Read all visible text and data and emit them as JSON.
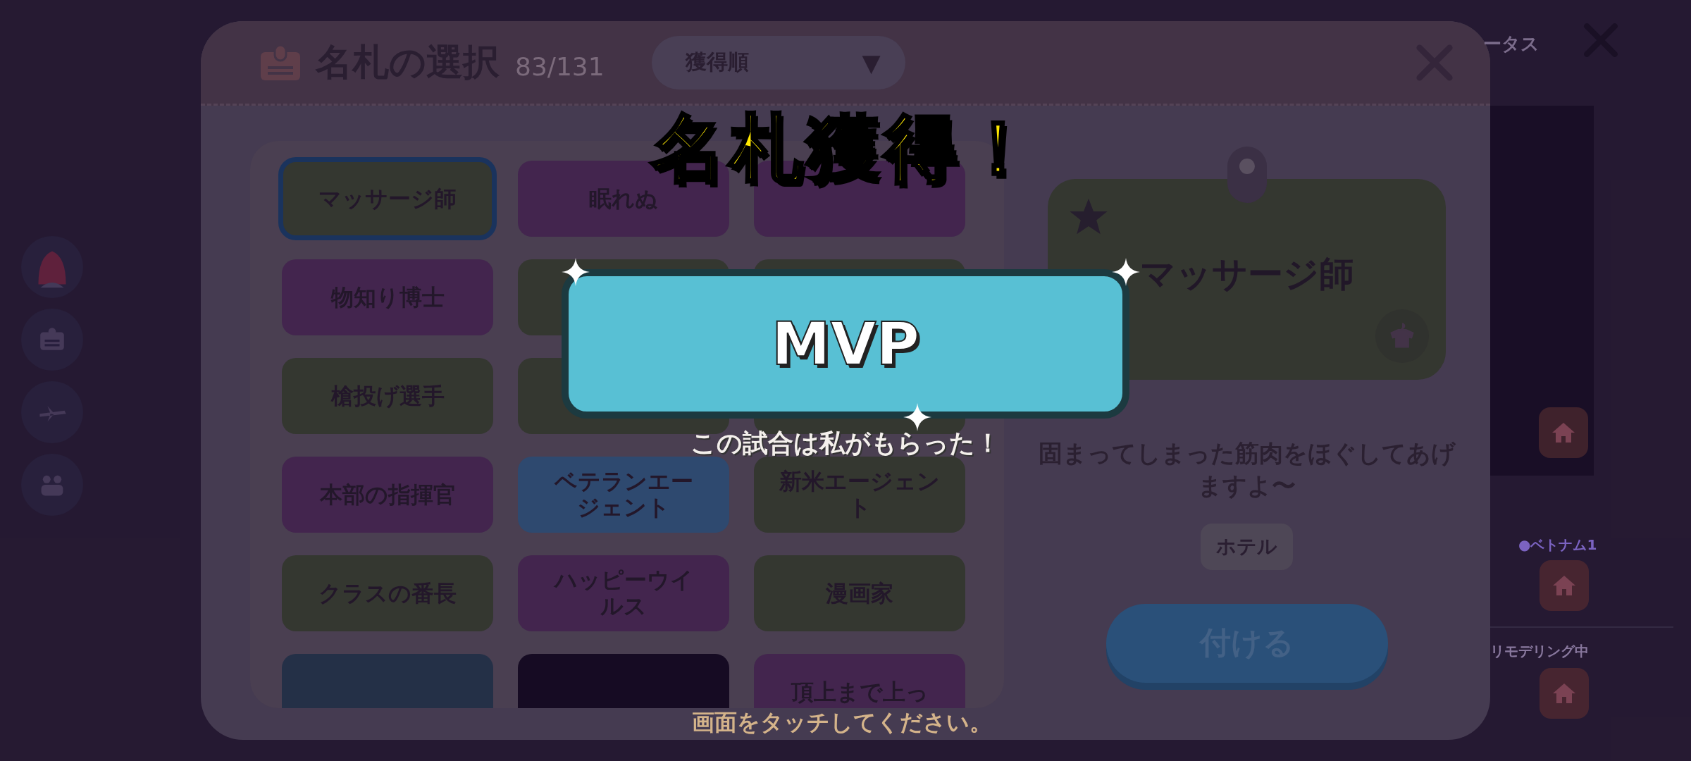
{
  "sidebar": {
    "items": [
      {
        "kind": "avatar"
      },
      {
        "kind": "badge"
      },
      {
        "kind": "plane"
      },
      {
        "kind": "group"
      }
    ]
  },
  "background": {
    "status_label": "ータス",
    "region_label": "●ベトナム1",
    "remodel_label": "リモデリング中"
  },
  "dialog": {
    "title": "名札の選択",
    "count": "83/131",
    "sort": {
      "value": "獲得順",
      "caret": "▼"
    },
    "nameplates": [
      {
        "label": "マッサージ師",
        "color": "#3a3e33",
        "selected": true
      },
      {
        "label": "眠れぬ",
        "color": "#4a2a55",
        "selected": false
      },
      {
        "color": "#4a2a55",
        "selected": false
      },
      {
        "label": "物知り博士",
        "color": "#4a2a55",
        "selected": false
      },
      {
        "color": "#3a3e33",
        "selected": false
      },
      {
        "color": "#3a3e33",
        "selected": false
      },
      {
        "label": "槍投げ選手",
        "color": "#3a3e33",
        "selected": false
      },
      {
        "color": "#3a3e33",
        "selected": false
      },
      {
        "color": "#3a3e33",
        "selected": false
      },
      {
        "label": "本部の指揮官",
        "color": "#4a2a55",
        "selected": false
      },
      {
        "label": "ベテランエージェント",
        "color": "#33527a",
        "selected": false
      },
      {
        "label": "新米エージェント",
        "color": "#3a3e33",
        "selected": false
      },
      {
        "label": "クラスの番長",
        "color": "#3a3e33",
        "selected": false
      },
      {
        "label": "ハッピーウイルス",
        "color": "#4a2a55",
        "selected": false
      },
      {
        "label": "漫画家",
        "color": "#3a3e33",
        "selected": false
      },
      {
        "color": "#27364d",
        "selected": false
      },
      {
        "color": "#170c24",
        "selected": false
      },
      {
        "label": "頂上まで上っ",
        "color": "#4a2a55",
        "selected": false
      }
    ],
    "preview": {
      "name": "マッサージ師",
      "description": "固まってしまった筋肉をほぐしてあげますよ〜",
      "tag": "ホテル",
      "equip_button": "付ける"
    }
  },
  "popup": {
    "heading": "名札獲得！",
    "award": "MVP",
    "quote": "この試合は私がもらった！",
    "hint": "画面をタッチしてください。"
  }
}
